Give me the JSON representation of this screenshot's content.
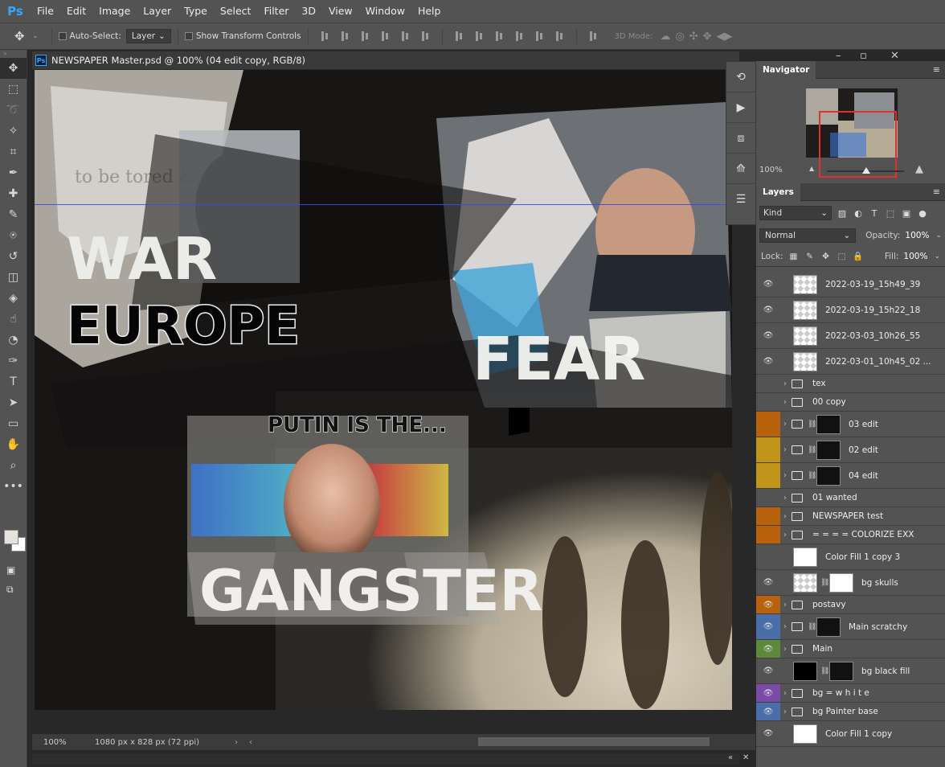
{
  "menubar": {
    "logo": "Ps",
    "items": [
      "File",
      "Edit",
      "Image",
      "Layer",
      "Type",
      "Select",
      "Filter",
      "3D",
      "View",
      "Window",
      "Help"
    ]
  },
  "options": {
    "auto_select_label": "Auto-Select:",
    "auto_select_value": "Layer",
    "transform_label": "Show Transform Controls",
    "mode_3d_label": "3D Mode:"
  },
  "document": {
    "tab_title": "NEWSPAPER Master.psd @ 100% (04 edit copy, RGB/8)",
    "zoom": "100%",
    "doc_info": "1080 px x 828 px (72 ppi)"
  },
  "canvas_text": {
    "word_europe": "EUROPE",
    "word_war": "WAR",
    "word_gangster": "GANGSTER",
    "word_fear": "FEAR",
    "small_text": "PUTIN IS THE...",
    "news_text": "to be tored & on trial"
  },
  "navigator": {
    "title": "Navigator",
    "zoom": "100%"
  },
  "layers_panel": {
    "title": "Layers",
    "filter_kind": "Kind",
    "blend_mode": "Normal",
    "opacity_label": "Opacity:",
    "opacity_value": "100%",
    "lock_label": "Lock:",
    "fill_label": "Fill:",
    "fill_value": "100%",
    "layers": [
      {
        "name": "2022-03-19_15h49_39",
        "visible": true,
        "type": "raster",
        "color": ""
      },
      {
        "name": "2022-03-19_15h22_18",
        "visible": true,
        "type": "raster",
        "color": ""
      },
      {
        "name": "2022-03-03_10h26_55",
        "visible": true,
        "type": "raster",
        "color": ""
      },
      {
        "name": "2022-03-01_10h45_02 ...",
        "visible": true,
        "type": "raster",
        "color": ""
      },
      {
        "name": "tex",
        "visible": false,
        "type": "group",
        "color": ""
      },
      {
        "name": "00 copy",
        "visible": false,
        "type": "group",
        "color": ""
      },
      {
        "name": "03 edit",
        "visible": false,
        "type": "group-mask",
        "color": "#b8620e"
      },
      {
        "name": "02 edit",
        "visible": false,
        "type": "group-mask",
        "color": "#c0951a"
      },
      {
        "name": "04 edit",
        "visible": false,
        "type": "group-mask",
        "color": "#c0951a"
      },
      {
        "name": "01 wanted",
        "visible": false,
        "type": "group",
        "color": ""
      },
      {
        "name": "NEWSPAPER test",
        "visible": false,
        "type": "group",
        "color": "#b8620e"
      },
      {
        "name": "= = = =  COLORIZE EXX",
        "visible": false,
        "type": "group",
        "color": "#b8620e"
      },
      {
        "name": "Color Fill 1 copy 3",
        "visible": false,
        "type": "fill-white",
        "color": ""
      },
      {
        "name": "bg skulls",
        "visible": true,
        "type": "raster-mask",
        "color": ""
      },
      {
        "name": "postavy",
        "visible": true,
        "type": "group",
        "color": "#b8620e"
      },
      {
        "name": "Main scratchy",
        "visible": true,
        "type": "group-mask",
        "color": "#4a6fa8"
      },
      {
        "name": "Main",
        "visible": true,
        "type": "group",
        "color": "#5c8a3a"
      },
      {
        "name": "bg black fill",
        "visible": true,
        "type": "fill-black",
        "color": ""
      },
      {
        "name": "bg = w h i t e",
        "visible": true,
        "type": "group",
        "color": "#7a4aa8"
      },
      {
        "name": "bg Painter base",
        "visible": true,
        "type": "group",
        "color": "#4a6fa8"
      },
      {
        "name": "Color Fill 1 copy",
        "visible": true,
        "type": "fill-white",
        "color": ""
      }
    ]
  },
  "tools": [
    "move-icon",
    "marquee-icon",
    "lasso-icon",
    "quick-select-icon",
    "crop-icon",
    "eyedropper-icon",
    "healing-icon",
    "brush-icon",
    "stamp-icon",
    "history-brush-icon",
    "eraser-icon",
    "bucket-icon",
    "smudge-icon",
    "dodge-icon",
    "pen-icon",
    "type-icon",
    "path-select-icon",
    "rectangle-icon",
    "hand-icon",
    "zoom-icon",
    "more-icon"
  ]
}
